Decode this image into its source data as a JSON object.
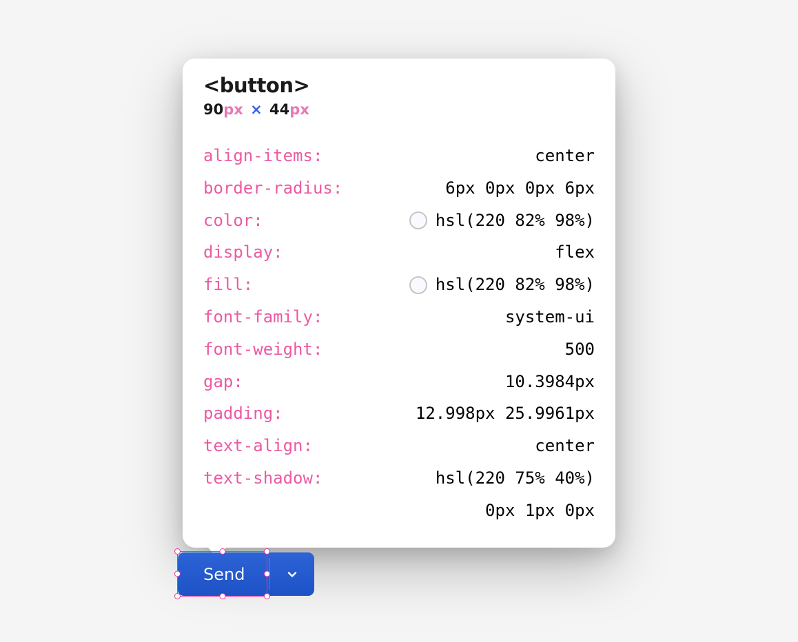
{
  "inspector": {
    "element_tag": "<button>",
    "dimensions": {
      "width_value": "90",
      "width_unit": "px",
      "times": "×",
      "height_value": "44",
      "height_unit": "px"
    },
    "properties": [
      {
        "name": "align-items:",
        "value": "center",
        "has_swatch": false
      },
      {
        "name": "border-radius:",
        "value": "6px 0px 0px 6px",
        "has_swatch": false
      },
      {
        "name": "color:",
        "value": "hsl(220 82% 98%)",
        "has_swatch": true
      },
      {
        "name": "display:",
        "value": "flex",
        "has_swatch": false
      },
      {
        "name": "fill:",
        "value": "hsl(220 82% 98%)",
        "has_swatch": true
      },
      {
        "name": "font-family:",
        "value": "system-ui",
        "has_swatch": false
      },
      {
        "name": "font-weight:",
        "value": "500",
        "has_swatch": false
      },
      {
        "name": "gap:",
        "value": "10.3984px",
        "has_swatch": false
      },
      {
        "name": "padding:",
        "value": "12.998px 25.9961px",
        "has_swatch": false
      },
      {
        "name": "text-align:",
        "value": "center",
        "has_swatch": false
      },
      {
        "name": "text-shadow:",
        "value": "hsl(220 75% 40%)",
        "value_line2": "0px 1px 0px",
        "has_swatch": false
      }
    ]
  },
  "buttons": {
    "send_label": "Send"
  }
}
